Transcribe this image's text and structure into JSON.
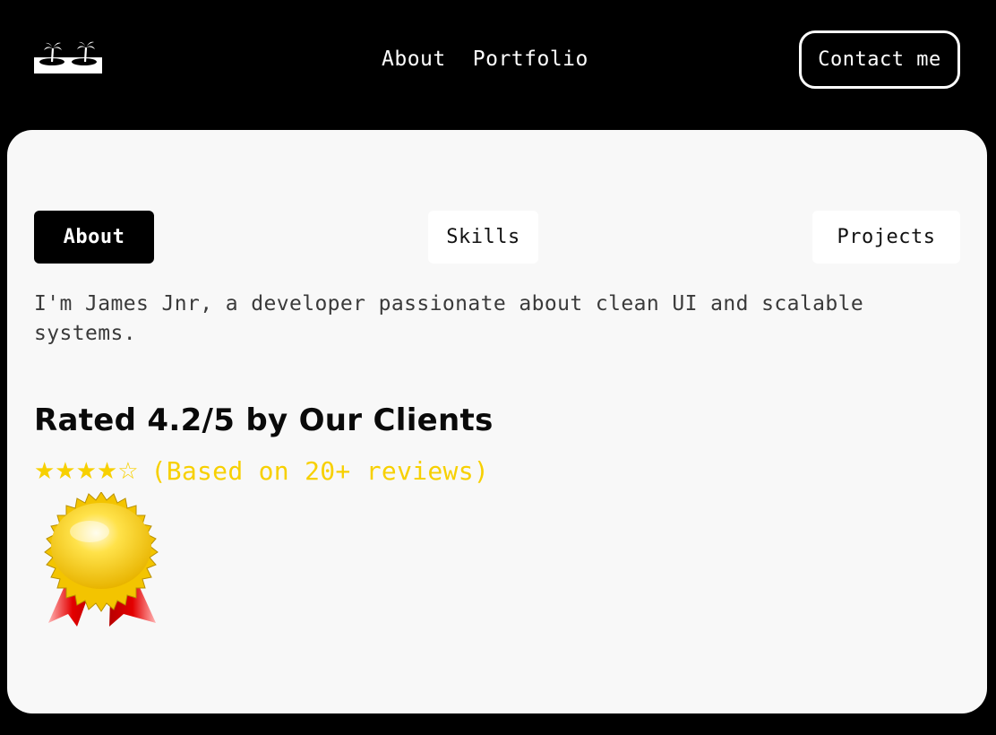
{
  "header": {
    "logo_icon": "palm-island-icon",
    "nav_links": [
      {
        "label": "About"
      },
      {
        "label": "Portfolio"
      }
    ],
    "contact_label": "Contact me"
  },
  "tabs": [
    {
      "label": "About",
      "active": true
    },
    {
      "label": "Skills",
      "active": false
    },
    {
      "label": "Projects",
      "active": false
    }
  ],
  "about": {
    "text": "I'm James Jnr, a developer passionate about clean UI and scalable systems."
  },
  "rating": {
    "heading": "Rated 4.2/5 by Our Clients",
    "value": 4.2,
    "max": 5,
    "stars_text": "★★★★☆",
    "reviews_text": "(Based on 20+ reviews)",
    "badge_icon": "award-ribbon-icon",
    "star_color": "#f7d000"
  },
  "colors": {
    "background": "#000000",
    "card": "#f8f8f8",
    "accent": "#f7d000"
  }
}
